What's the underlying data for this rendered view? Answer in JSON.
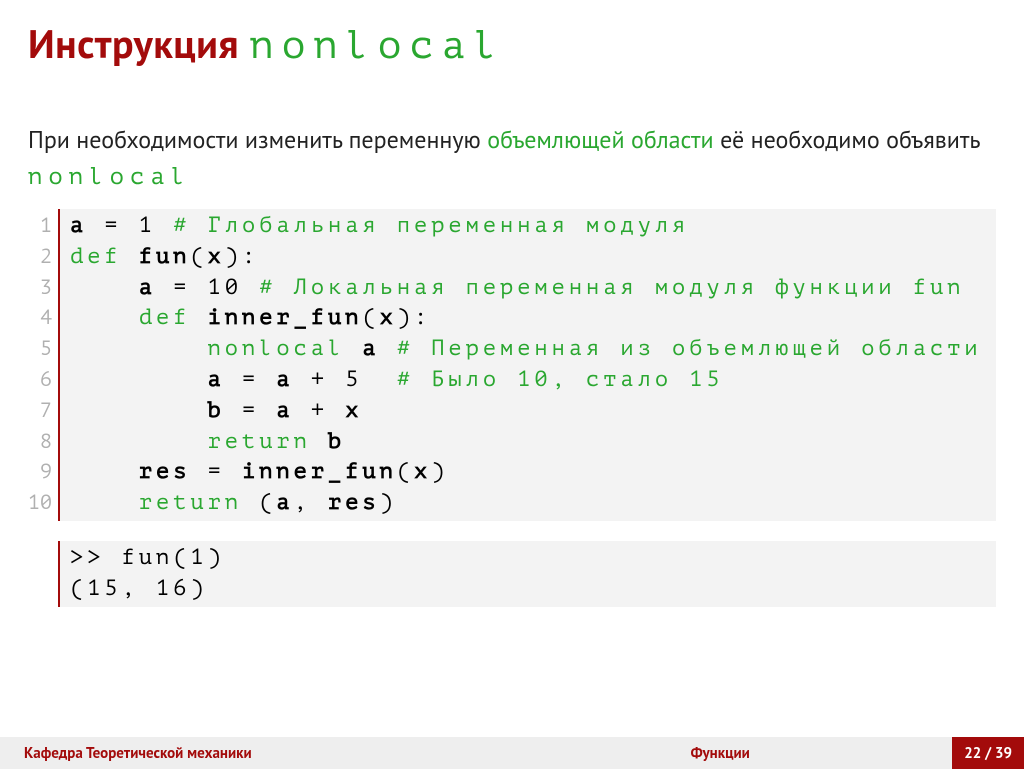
{
  "title": {
    "prefix": "Инструкция ",
    "keyword": "nonlocal"
  },
  "intro": {
    "part1": "При необходимости изменить переменную ",
    "hl1": "объемлющей области",
    "part2": " её необходимо объявить ",
    "kw": "nonlocal"
  },
  "code": {
    "lines": [
      "1",
      "2",
      "3",
      "4",
      "5",
      "6",
      "7",
      "8",
      "9",
      "10"
    ],
    "l1": {
      "a": "a",
      "eq": " = 1 ",
      "com": "# Глобальная переменная модуля"
    },
    "l2": {
      "def": "def ",
      "fn": "fun",
      "sig": "(",
      "x": "x",
      "sig2": "):"
    },
    "l3": {
      "ind": "    ",
      "a": "a",
      "eq": " = 10 ",
      "com": "# Локальная переменная модуля функции fun"
    },
    "l4": {
      "ind": "    ",
      "def": "def ",
      "fn": "inner_fun",
      "sig": "(",
      "x": "x",
      "sig2": "):"
    },
    "l5": {
      "ind": "        ",
      "kw": "nonlocal ",
      "a": "a",
      "sp": " ",
      "com": "# Переменная из объемлющей области"
    },
    "l6": {
      "ind": "        ",
      "a": "a",
      "eq": " = ",
      "a2": "a",
      "plus": " + 5  ",
      "com": "# Было 10, стало 15"
    },
    "l7": {
      "ind": "        ",
      "b": "b",
      "eq": " = ",
      "a": "a",
      "plus": " + ",
      "x": "x"
    },
    "l8": {
      "ind": "        ",
      "ret": "return ",
      "b": "b"
    },
    "l9": {
      "ind": "    ",
      "res": "res",
      "eq": " = ",
      "fn": "inner_fun",
      "sig": "(",
      "x": "x",
      "sig2": ")"
    },
    "l10": {
      "ind": "    ",
      "ret": "return ",
      "sig": "(",
      "a": "a",
      "c": ", ",
      "res": "res",
      "sig2": ")"
    }
  },
  "output": {
    "l1": ">> fun(1)",
    "l2": "(15, 16)"
  },
  "footer": {
    "left": "Кафедра Теоретической механики",
    "mid": "Функции",
    "right": "22 / 39"
  }
}
